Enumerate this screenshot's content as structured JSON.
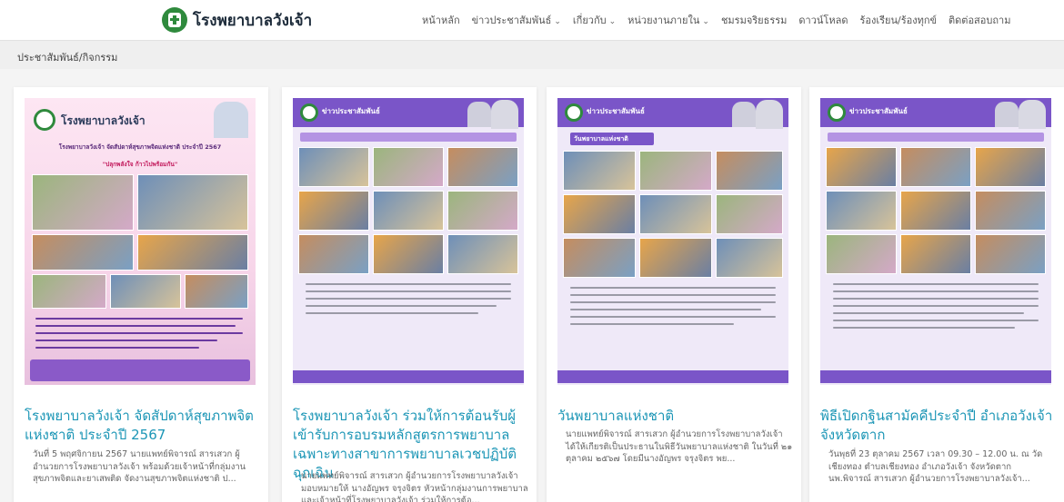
{
  "header": {
    "site_name": "โรงพยาบาลวังเจ้า",
    "nav": [
      {
        "label": "หน้าหลัก",
        "dropdown": false
      },
      {
        "label": "ข่าวประชาสัมพันธ์",
        "dropdown": true
      },
      {
        "label": "เกี่ยวกับ",
        "dropdown": true
      },
      {
        "label": "หน่วยงานภายใน",
        "dropdown": true
      },
      {
        "label": "ชมรมจริยธรรม",
        "dropdown": false
      },
      {
        "label": "ดาวน์โหลด",
        "dropdown": false
      },
      {
        "label": "ร้องเรียน/ร้องทุกข์",
        "dropdown": false
      },
      {
        "label": "ติดต่อสอบถาม",
        "dropdown": false
      }
    ]
  },
  "breadcrumb": "ประชาสัมพันธ์/กิจกรรม",
  "posts": [
    {
      "title": "โรงพยาบาลวังเจ้า จัดสัปดาห์สุขภาพจิต แห่งชาติ ประจำปี 2567",
      "excerpt": "วันที่ 5 พฤศจิกายน 2567 นายแพทย์พิจารณ์ สารเสวก ผู้อำนวยการโรงพยาบาลวังเจ้า พร้อมด้วยเจ้าหน้าที่กลุ่มงานสุขภาพจิตและยาเสพติด จัดงานสุขภาพจิตแห่งชาติ ป...",
      "poster": {
        "site_name": "โรงพยาบาลวังเจ้า",
        "headline": "โรงพยาบาลวังเจ้า จัดสัปดาห์สุขภาพจิตแห่งชาติ ประจำปี 2567",
        "slogan": "\"ปลุกพลังใจ ก้าวไปพร้อมกัน\""
      }
    },
    {
      "title": "โรงพยาบาลวังเจ้า ร่วมให้การต้อนรับผู้เข้ารับการอบรมหลักสูตรการพยาบาลเฉพาะทางสาขาการพยาบาลเวชปฏิบัติฉุกเฉิน",
      "excerpt": "นายแพทย์พิจารณ์ สารเสวก ผู้อำนวยการโรงพยาบาลวังเจ้า มอบหมายให้ นางอัญพร จรุงจิตร หัวหน้ากลุ่มงานการพยาบาล และเจ้าหน้าที่โรงพยาบาลวังเจ้า ร่วมให้การต้อ...",
      "poster": {
        "header": "ข่าวประชาสัมพันธ์"
      }
    },
    {
      "title": "วันพยาบาลแห่งชาติ",
      "excerpt": "นายแพทย์พิจารณ์ สารเสวก ผู้อำนวยการโรงพยาบาลวังเจ้า ได้ให้เกียรติเป็นประธานในพิธีวันพยาบาลแห่งชาติ ในวันที่ ๒๑ ตุลาคม ๒๕๖๗ โดยมีนางอัญพร จรุงจิตร พย...",
      "poster": {
        "header": "ข่าวประชาสัมพันธ์",
        "band": "วันพยาบาลแห่งชาติ"
      }
    },
    {
      "title": "พิธีเปิดกฐินสามัคคีประจำปี อำเภอวังเจ้า จังหวัดตาก",
      "excerpt": "วันพุธที่ 23 ตุลาคม 2567 เวลา 09.30 – 12.00 น. ณ วัดเชียงทอง ตำบลเชียงทอง อำเภอวังเจ้า จังหวัดตาก นพ.พิจารณ์ สารเสวก ผู้อำนวยการโรงพยาบาลวังเจ้า...",
      "poster": {
        "header": "ข่าวประชาสัมพันธ์"
      }
    }
  ]
}
